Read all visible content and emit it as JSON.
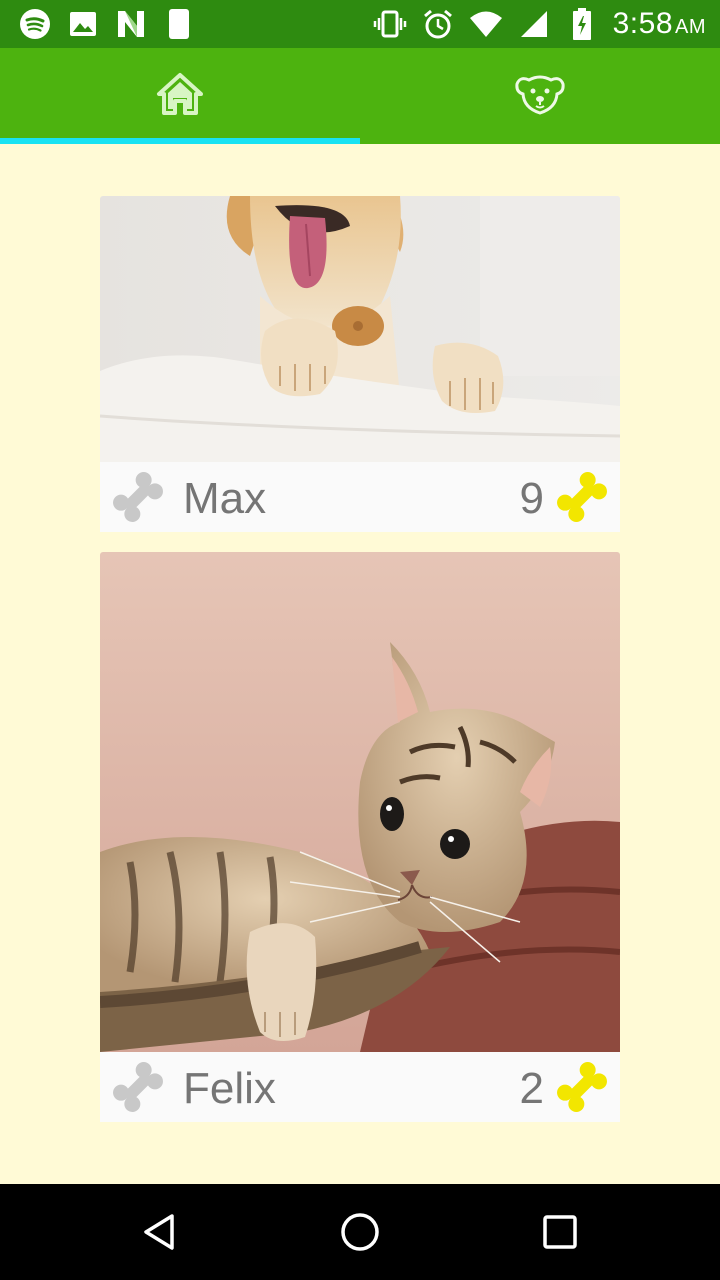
{
  "status_bar": {
    "time": "3:58",
    "ampm": "AM",
    "left_icons": [
      "spotify-icon",
      "gallery-icon",
      "n-app-icon",
      "phone-night-icon"
    ],
    "right_icons": [
      "vibrate-icon",
      "alarm-icon",
      "wifi-icon",
      "signal-icon",
      "battery-icon"
    ]
  },
  "tabs": [
    {
      "name": "home",
      "icon": "home-icon",
      "selected": true
    },
    {
      "name": "pets",
      "icon": "dog-face-icon",
      "selected": false
    }
  ],
  "colors": {
    "status_bar": "#2e8b10",
    "app_bar": "#4db30f",
    "indicator": "#19e2f2",
    "background": "#fffad6",
    "bone_gray": "#c8c8c8",
    "bone_yellow": "#f2e600",
    "text": "#757575"
  },
  "pets": [
    {
      "name": "Max",
      "count": "9",
      "photo": "dog-photo"
    },
    {
      "name": "Felix",
      "count": "2",
      "photo": "cat-photo"
    }
  ],
  "nav": [
    "back-button",
    "home-button",
    "recents-button"
  ]
}
